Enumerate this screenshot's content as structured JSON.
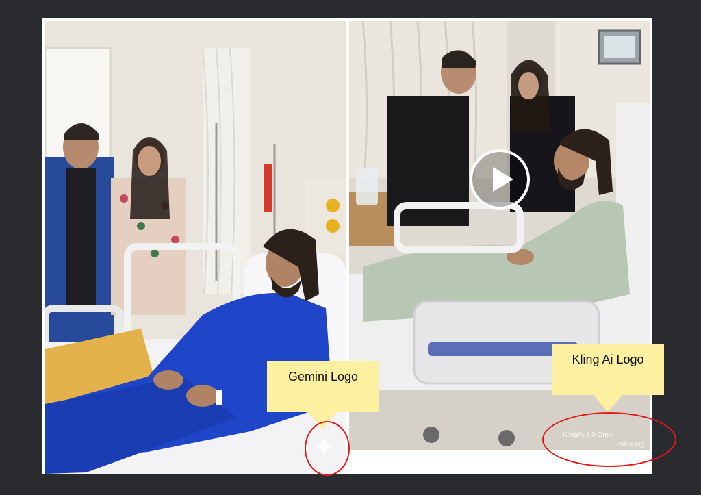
{
  "callouts": {
    "gemini": "Gemini Logo",
    "kling": "Kling Ai Logo"
  },
  "watermarks": {
    "kling": "KlingAi 3.0 Omni",
    "credit": "Zakia afg"
  },
  "icons": {
    "play": "play-icon",
    "gemini": "gemini-sparkle-icon"
  },
  "colors": {
    "background": "#2a2b2f",
    "callout": "#fdf0a0",
    "ring": "#e01a1a"
  }
}
